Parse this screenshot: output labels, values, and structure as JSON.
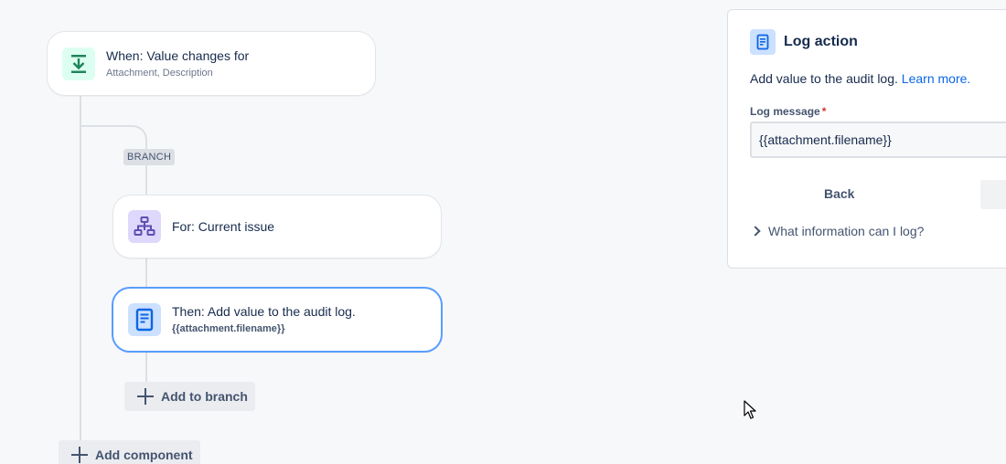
{
  "flow": {
    "trigger": {
      "title": "When: Value changes for",
      "subtitle": "Attachment, Description"
    },
    "branch_label": "BRANCH",
    "condition": {
      "title": "For: Current issue"
    },
    "action": {
      "title": "Then: Add value to the audit log.",
      "subtitle": "{{attachment.filename}}"
    },
    "add_to_branch_label": "Add to branch",
    "add_component_label": "Add component"
  },
  "panel": {
    "title": "Log action",
    "description": "Add value to the audit log.",
    "learn_more": "Learn more.",
    "field_label": "Log message",
    "field_required_mark": "*",
    "field_value": "{{attachment.filename}}",
    "back_label": "Back",
    "expander_label": "What information can I log?"
  },
  "colors": {
    "trigger_icon_bg": "#dcfff1",
    "trigger_icon_fg": "#1f845a",
    "condition_icon_bg": "#dfd8fd",
    "condition_icon_fg": "#5e4db2",
    "action_icon_bg": "#cce0ff",
    "action_icon_fg": "#0c66e4",
    "selected_border": "#579dff",
    "link": "#0c66e4"
  },
  "icons": {
    "trigger": "download-arrow-icon",
    "condition": "hierarchy-icon",
    "action": "document-log-icon",
    "panel": "document-log-icon",
    "add": "plus-icon",
    "expander": "chevron-right-icon",
    "cursor": "mouse-cursor-icon"
  }
}
